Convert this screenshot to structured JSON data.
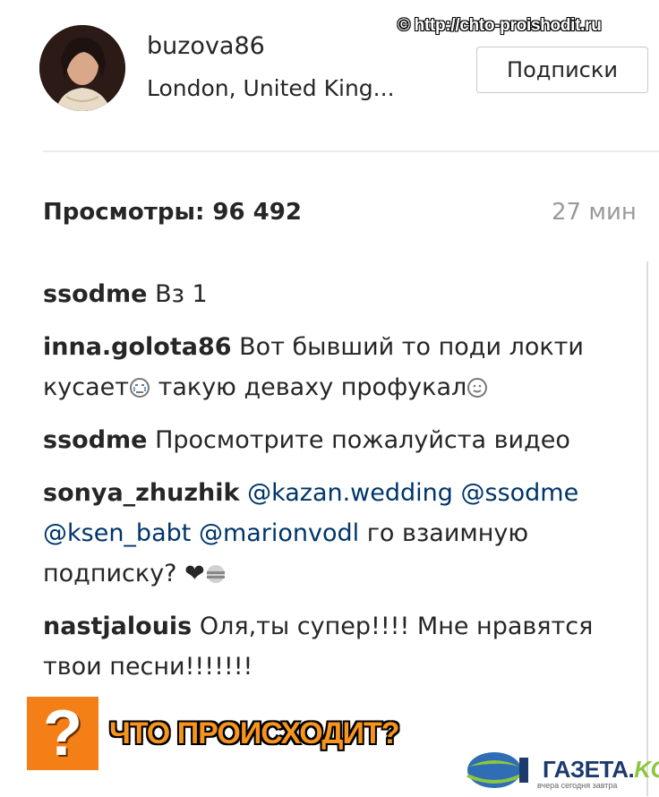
{
  "watermark": "© http://chto-proishodit.ru",
  "post": {
    "username": "buzova86",
    "location": "London, United King...",
    "follow_button": "Подписки",
    "views": "Просмотры: 96 492",
    "time": "27 мин"
  },
  "comments": [
    {
      "user": "ssodme",
      "text": "Вз 1"
    },
    {
      "user": "inna.golota86",
      "text_a": "Вот бывший то поди локти кусает",
      "text_b": " такую деваху профукал"
    },
    {
      "user": "ssodme",
      "text": "Просмотрите пожалуйста видео"
    },
    {
      "user": "sonya_zhuzhik",
      "mentions": [
        "@kazan.wedding",
        "@ssodme",
        "@ksen_babt",
        "@marionvodl"
      ],
      "text": "го взаимную подписку? ❤"
    },
    {
      "user": "nastjalouis",
      "text": "Оля,ты супер!!!! Мне нравятся твои песни!!!!!!!"
    }
  ],
  "badge": {
    "symbol": "?",
    "text": "ЧТО ПРОИСХОДИТ?"
  },
  "logo": {
    "word": "ГАЗЕТА.",
    "suffix": "KG",
    "tagline": "вчера сегодня завтра"
  },
  "colors": {
    "badge_orange": "#f57f17",
    "mention_blue": "#003569",
    "logo_green": "#8cc63f"
  }
}
